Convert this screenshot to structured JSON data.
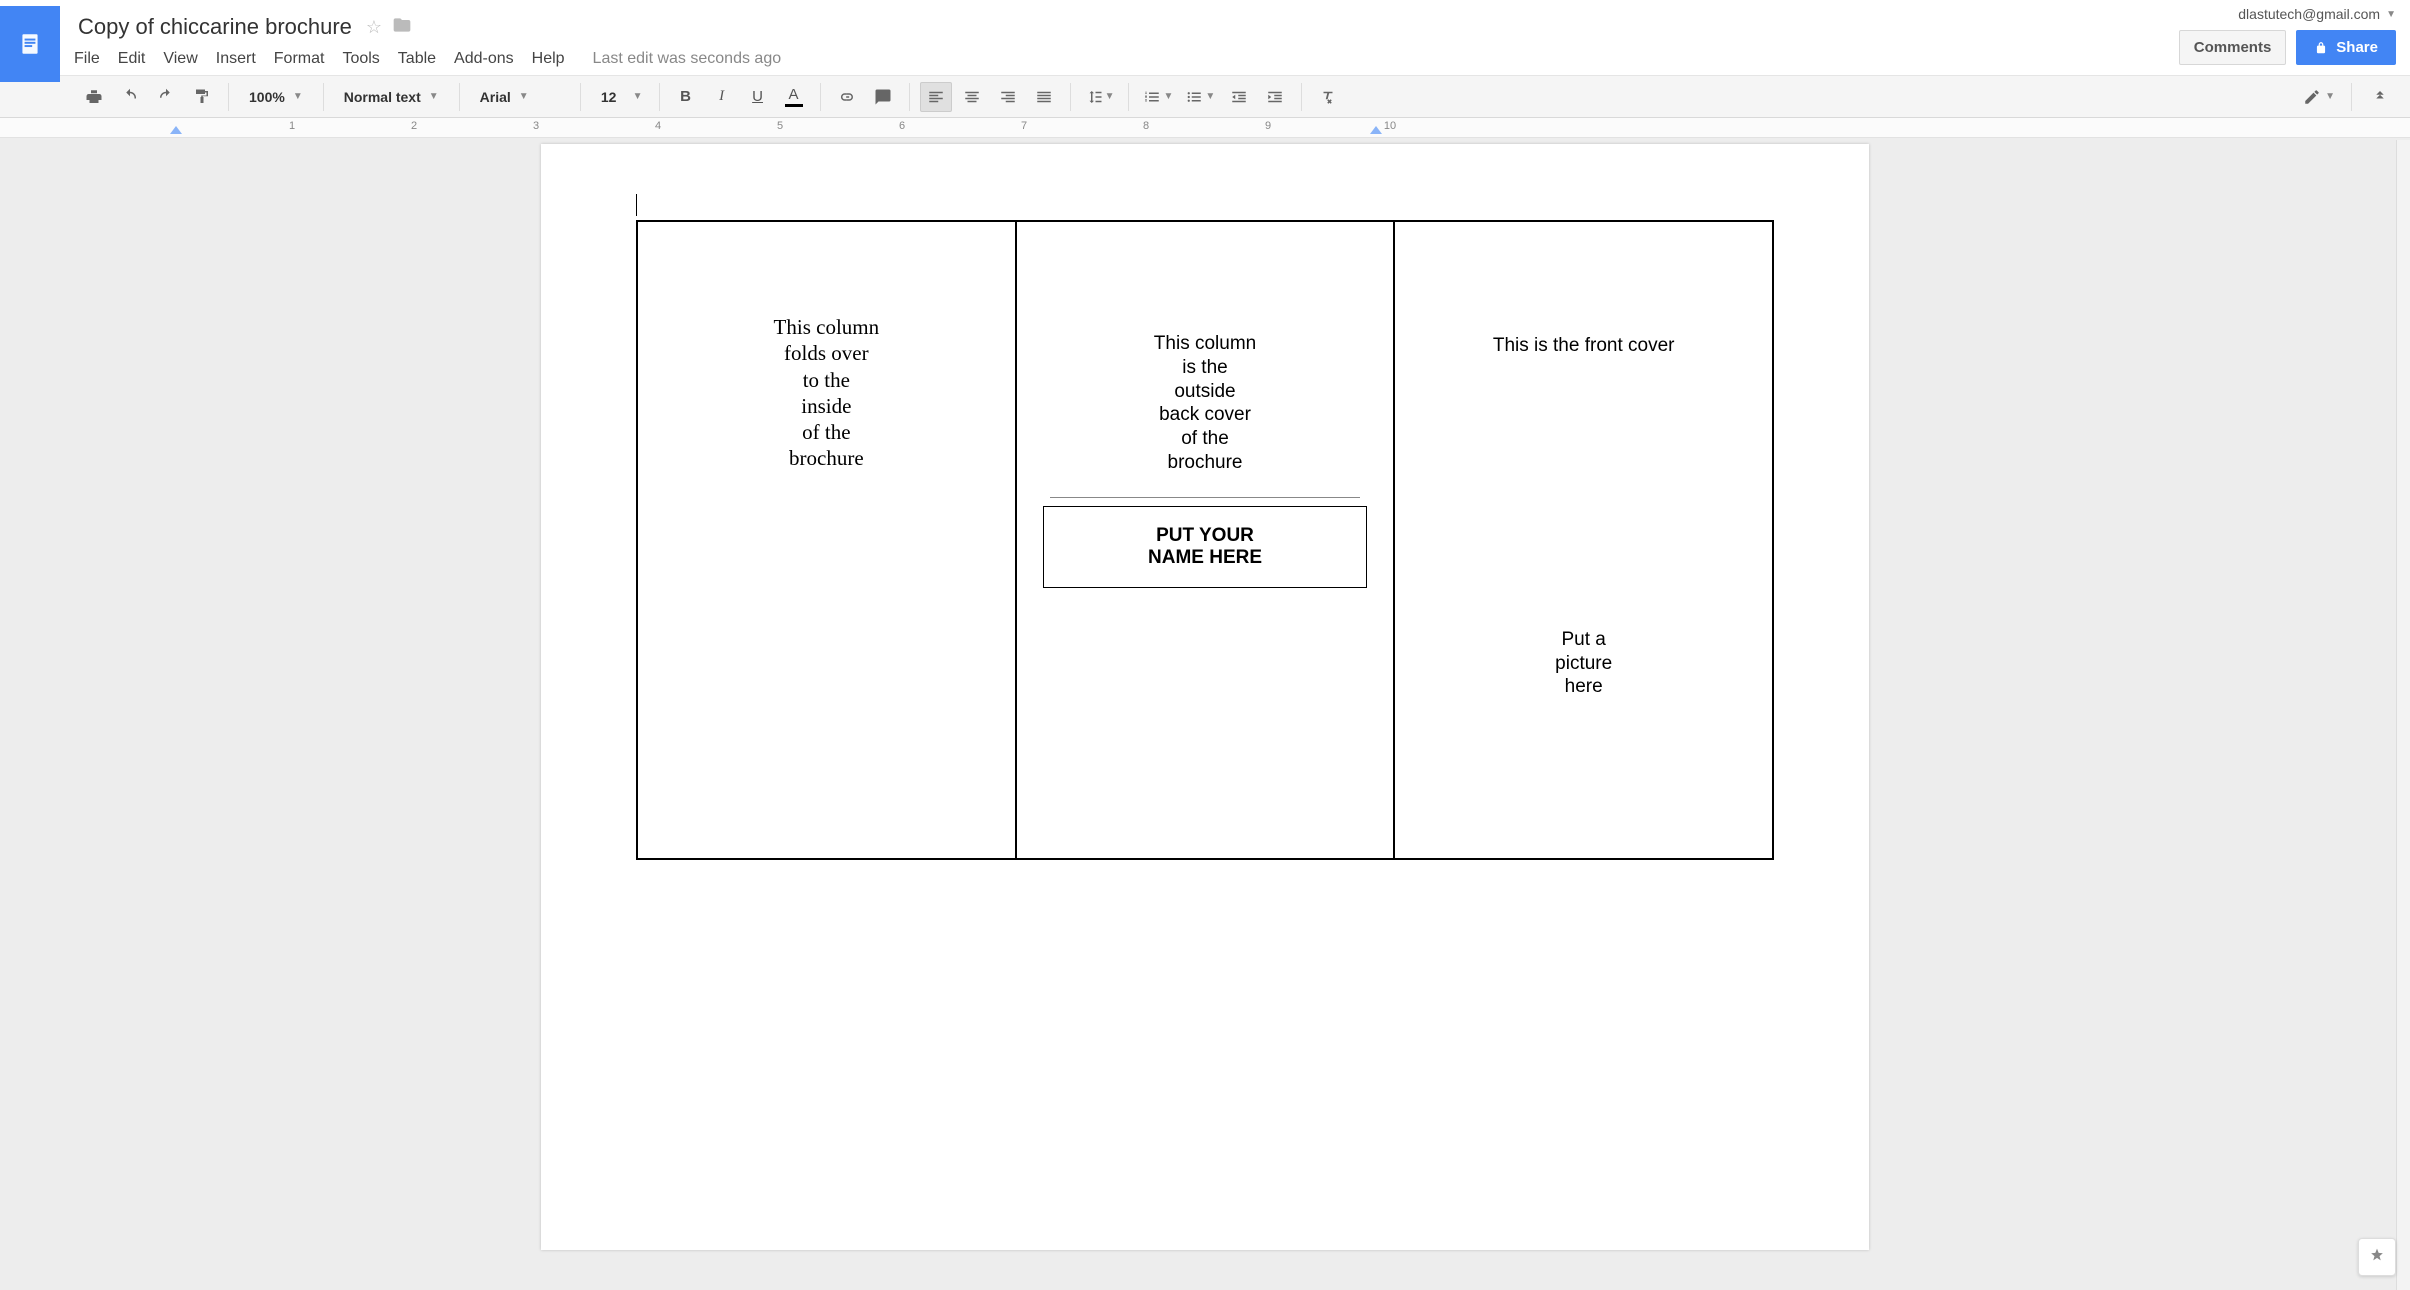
{
  "account": {
    "email": "dlastutech@gmail.com"
  },
  "doc": {
    "title": "Copy of chiccarine brochure",
    "last_edit": "Last edit was seconds ago"
  },
  "menu": {
    "file": "File",
    "edit": "Edit",
    "view": "View",
    "insert": "Insert",
    "format": "Format",
    "tools": "Tools",
    "table": "Table",
    "addons": "Add-ons",
    "help": "Help"
  },
  "buttons": {
    "comments": "Comments",
    "share": "Share"
  },
  "toolbar": {
    "zoom": "100%",
    "styles": "Normal text",
    "font": "Arial",
    "font_size": "12"
  },
  "ruler": {
    "nums": [
      "1",
      "2",
      "3",
      "4",
      "5",
      "6",
      "7",
      "8",
      "9",
      "10"
    ]
  },
  "brochure": {
    "col1": "This column\nfolds over\nto the\ninside\nof the\nbrochure",
    "col2_top": "This column\nis the\noutside\nback cover\nof the\nbrochure",
    "col2_box": "PUT YOUR\nNAME HERE",
    "col3_title": "This is the front cover",
    "col3_pic": "Put a\npicture\nhere"
  }
}
